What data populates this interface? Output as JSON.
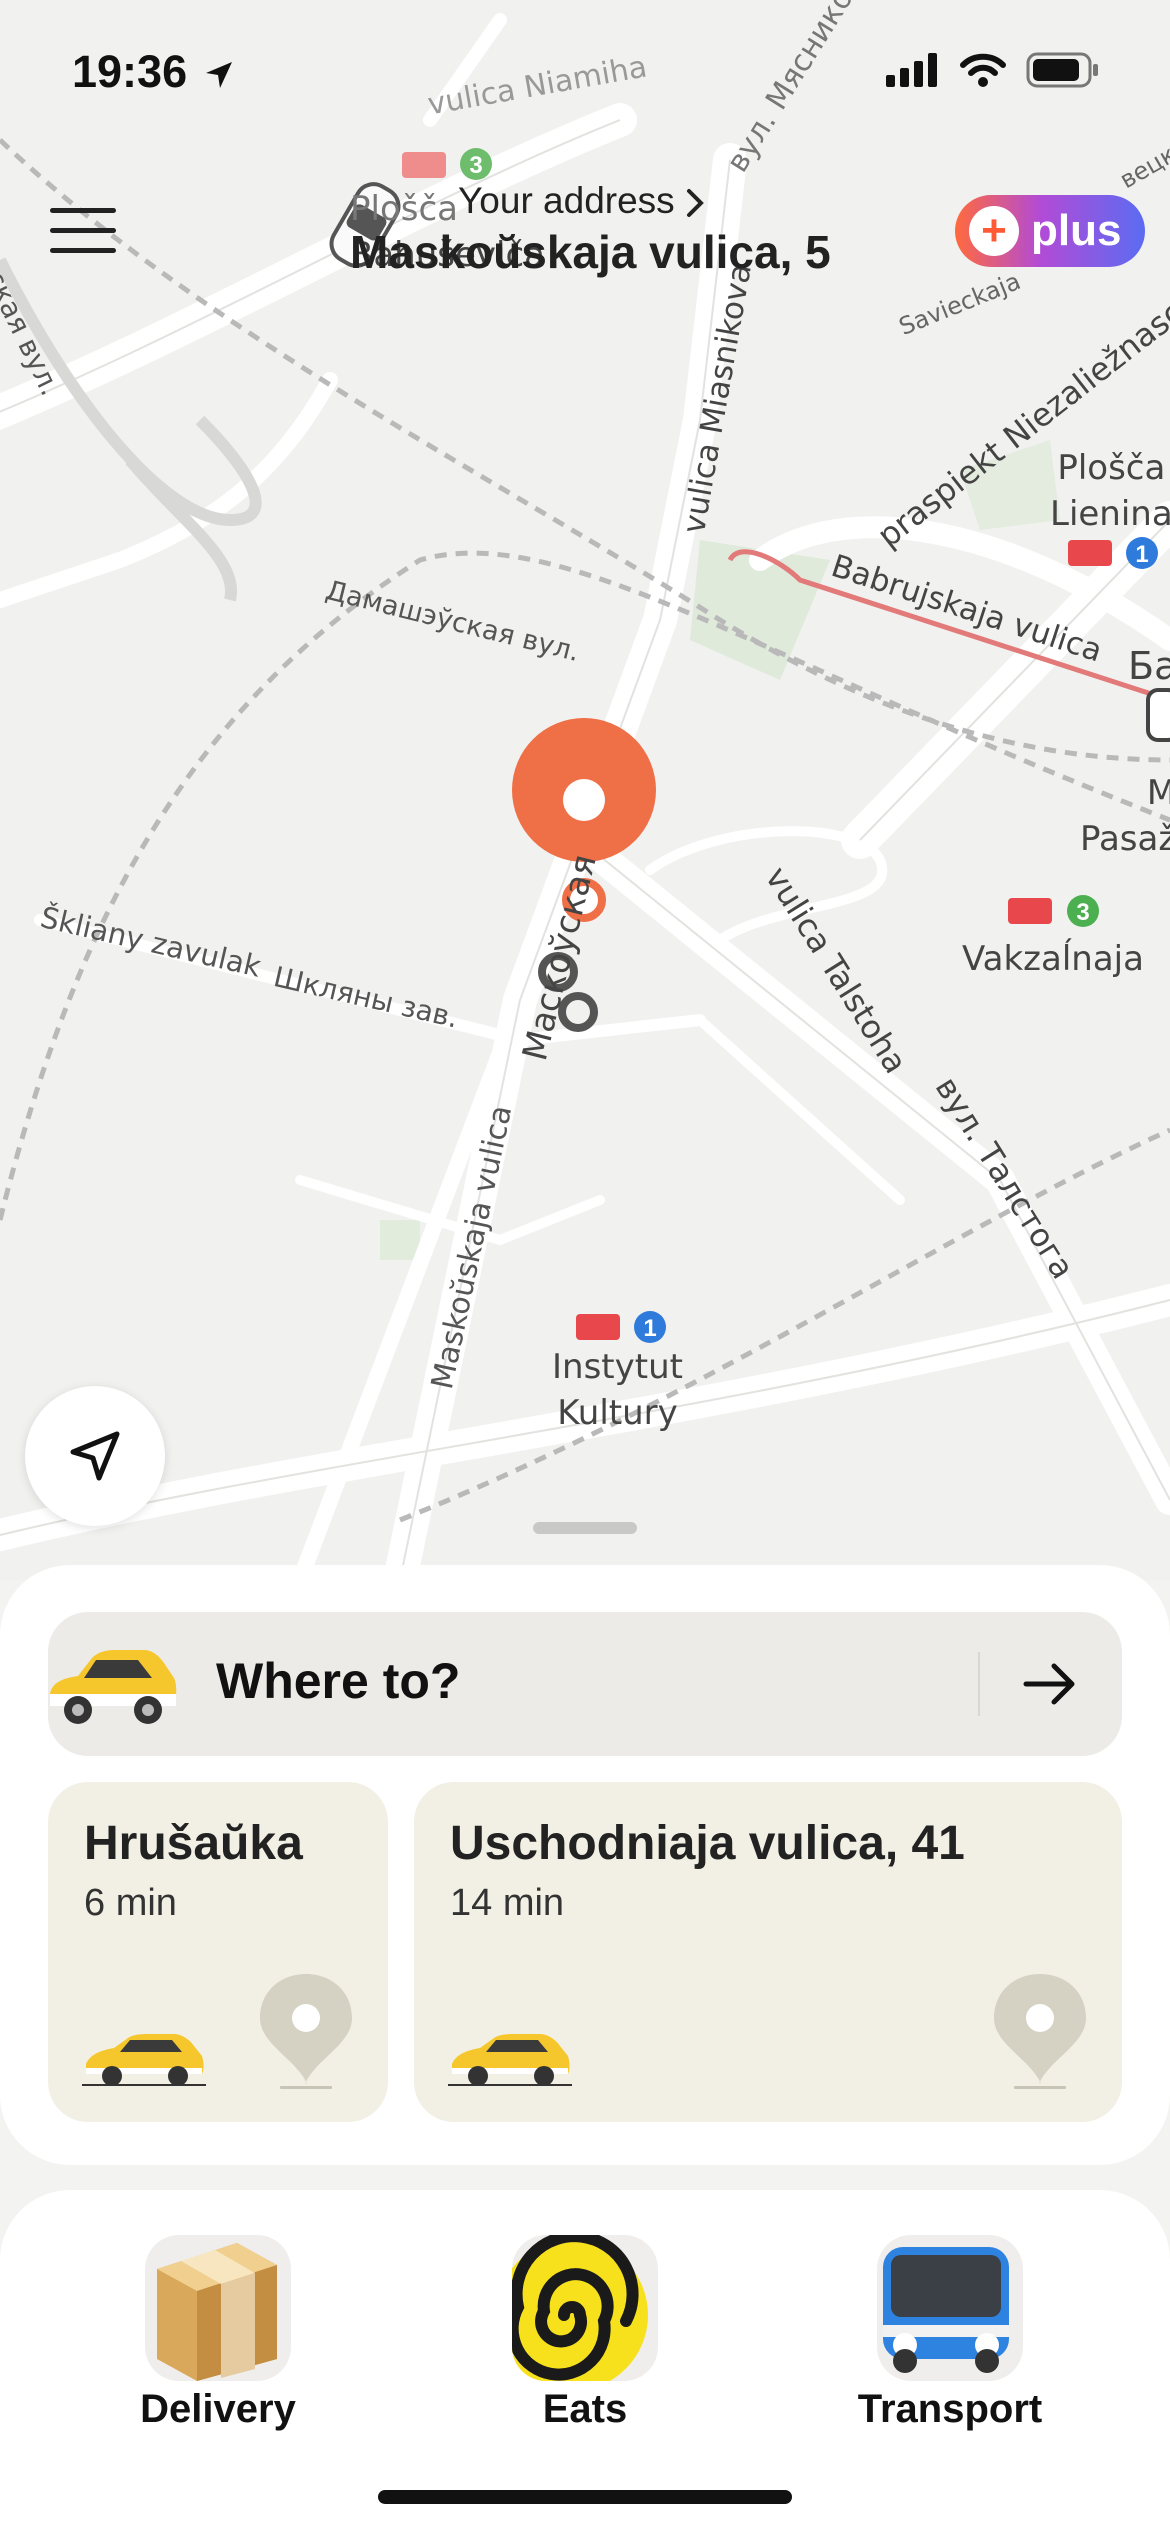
{
  "status_bar": {
    "time": "19:36"
  },
  "header": {
    "address_caption": "Your address",
    "address": "Maskoŭskaja vulica, 5",
    "plus_label": "plus"
  },
  "map": {
    "street_labels": [
      "vulica Niamiha",
      "вул. Мясникова",
      "Savieckaja",
      "вецк",
      "vulica Miasnikova",
      "praspiekt Niezaliežnasci",
      "Babrujskaja vulica",
      "Дамашэўская вул.",
      "ская вул.",
      "vulica Talstoha",
      "вул. Талстога",
      "Škliany zavulak",
      "Шкляны зав.",
      "Маскоўская",
      "Maskoŭskaja vulica"
    ],
    "poi_labels": [
      {
        "text": "Plošča Bahuševiča",
        "line1": "Plošča",
        "line2": "Bahuševiča",
        "metro": "3"
      },
      {
        "text": "Plošča Lienina",
        "line1": "Plošča",
        "line2": "Lienina",
        "metro": "1"
      },
      {
        "text": "Vakzaĺnaja",
        "metro": "3"
      },
      {
        "text": "Instytut Kultury",
        "line1": "Instytut",
        "line2": "Kultury",
        "metro": "1"
      },
      {
        "text": "M Pasaž",
        "line1": "M",
        "line2": "Pasaž"
      }
    ],
    "edge_labels": [
      "Ба"
    ]
  },
  "sheet": {
    "where_to": "Where to?",
    "destinations": [
      {
        "title": "Hrušaŭka",
        "time": "6 min"
      },
      {
        "title": "Uschodniaja vulica, 41",
        "time": "14 min"
      }
    ]
  },
  "services": [
    {
      "label": "Delivery",
      "icon": "box-icon"
    },
    {
      "label": "Eats",
      "icon": "spiral-icon"
    },
    {
      "label": "Transport",
      "icon": "bus-icon"
    }
  ],
  "colors": {
    "pin": "#ef6f47",
    "plus_gradient": [
      "#ff6a3d",
      "#b24bd6",
      "#5b6cf2"
    ],
    "card": "#f2f0e4",
    "metro_red": "#e8484b",
    "metro_green": "#4caf50",
    "metro_blue": "#2f7bdc"
  }
}
